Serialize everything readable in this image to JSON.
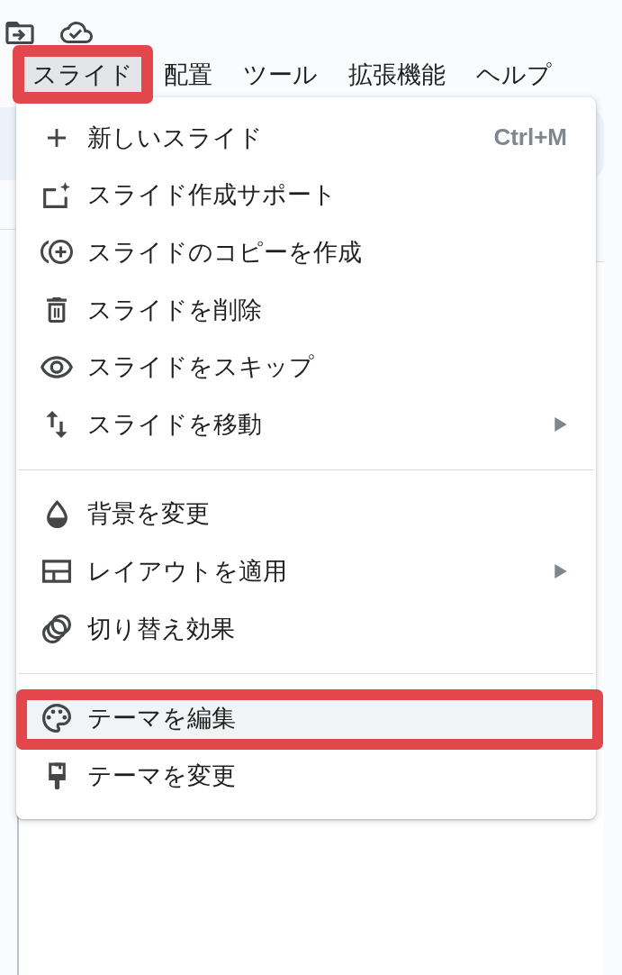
{
  "menu_bar": [
    {
      "label": "スライド",
      "selected": true,
      "annotated": true
    },
    {
      "label": "配置",
      "selected": false,
      "annotated": false
    },
    {
      "label": "ツール",
      "selected": false,
      "annotated": false
    },
    {
      "label": "拡張機能",
      "selected": false,
      "annotated": false
    },
    {
      "label": "ヘルプ",
      "selected": false,
      "annotated": false
    }
  ],
  "menu": {
    "sections": [
      {
        "items": [
          {
            "label": "新しいスライド",
            "shortcut": "Ctrl+M",
            "submenu": false,
            "selected": false,
            "annotated": false
          },
          {
            "label": "スライド作成サポート",
            "submenu": false,
            "selected": false,
            "annotated": false
          },
          {
            "label": "スライドのコピーを作成",
            "submenu": false,
            "selected": false,
            "annotated": false
          },
          {
            "label": "スライドを削除",
            "submenu": false,
            "selected": false,
            "annotated": false
          },
          {
            "label": "スライドをスキップ",
            "submenu": false,
            "selected": false,
            "annotated": false
          },
          {
            "label": "スライドを移動",
            "submenu": true,
            "selected": false,
            "annotated": false
          }
        ]
      },
      {
        "items": [
          {
            "label": "背景を変更",
            "submenu": false,
            "selected": false,
            "annotated": false
          },
          {
            "label": "レイアウトを適用",
            "submenu": true,
            "selected": false,
            "annotated": false
          },
          {
            "label": "切り替え効果",
            "submenu": false,
            "selected": false,
            "annotated": false
          }
        ]
      },
      {
        "items": [
          {
            "label": "テーマを編集",
            "submenu": false,
            "selected": true,
            "annotated": true
          },
          {
            "label": "テーマを変更",
            "submenu": false,
            "selected": false,
            "annotated": false
          }
        ]
      }
    ]
  }
}
